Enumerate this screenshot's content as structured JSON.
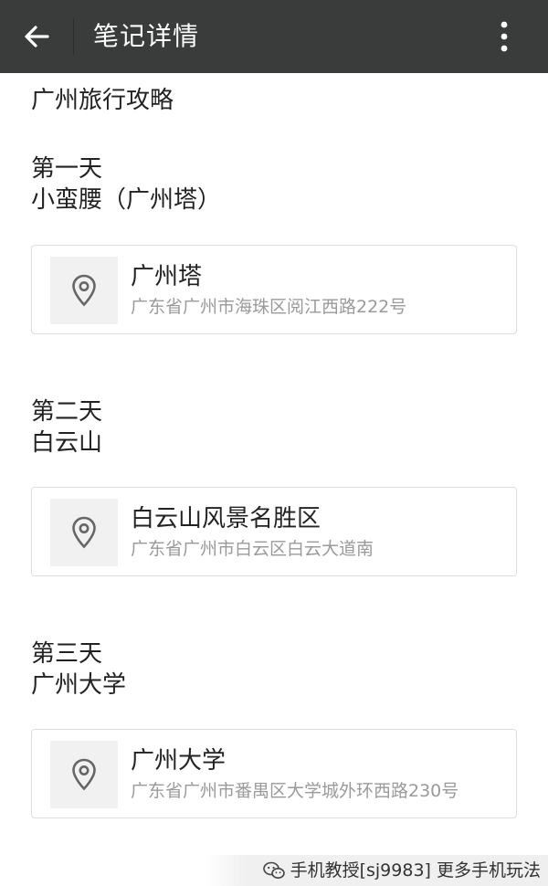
{
  "app_bar": {
    "title": "笔记详情",
    "back_icon": "arrow-left-icon",
    "more_icon": "more-vertical-icon"
  },
  "note": {
    "title": "广州旅行攻略",
    "days": [
      {
        "label": "第一天",
        "spot": "小蛮腰（广州塔）",
        "location": {
          "name": "广州塔",
          "address": "广东省广州市海珠区阅江西路222号",
          "icon": "map-pin-icon"
        }
      },
      {
        "label": "第二天",
        "spot": "白云山",
        "location": {
          "name": "白云山风景名胜区",
          "address": "广东省广州市白云区白云大道南",
          "icon": "map-pin-icon"
        }
      },
      {
        "label": "第三天",
        "spot": "广州大学",
        "location": {
          "name": "广州大学",
          "address": "广东省广州市番禺区大学城外环西路230号",
          "icon": "map-pin-icon"
        }
      }
    ]
  },
  "watermark": {
    "text": "手机教授[sj9983] 更多手机玩法",
    "icon": "wechat-icon"
  },
  "colors": {
    "app_bar_bg": "#3a3c3b",
    "secondary_text": "#9a9a9a",
    "card_border": "#dedede",
    "icon_box_bg": "#f1f1f1"
  }
}
